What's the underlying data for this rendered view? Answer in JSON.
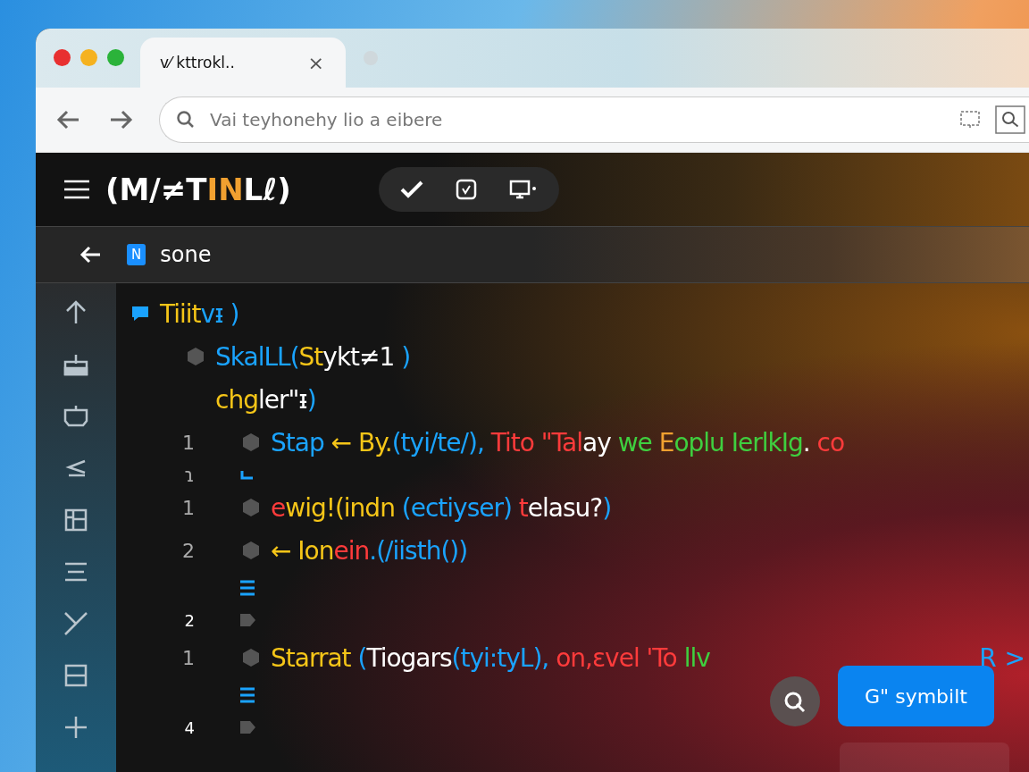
{
  "browser": {
    "tab": {
      "title": "ᴠ⁄ kttrokl..",
      "close": "×",
      "selected": true
    },
    "address": "Vai teyhonehy lio a eibere"
  },
  "app": {
    "title": [
      {
        "text": "(M/≠T",
        "color": "#ffffff"
      },
      {
        "text": "IN",
        "color": "#f0a030"
      },
      {
        "text": "Lℓ)",
        "color": "#ffffff"
      }
    ]
  },
  "breadcrumb": {
    "badge": "N",
    "label": "sone"
  },
  "code": [
    {
      "kind": "comment",
      "tokens": [
        {
          "text": "Tiiit",
          "color": "#f5c518"
        },
        {
          "text": "vᵻ )",
          "color": "#1aa3ff"
        }
      ],
      "children": [
        {
          "kind": "block",
          "tokens": [
            {
              "text": "SkalLL(",
              "color": "#1aa3ff"
            },
            {
              "text": "St",
              "color": "#f5c518"
            },
            {
              "text": "ykt≠1",
              "color": "#ffffff"
            },
            {
              "text": " )",
              "color": "#1aa3ff"
            }
          ]
        },
        {
          "kind": "plain",
          "tokens": [
            {
              "text": "chg",
              "color": "#f5c518"
            },
            {
              "text": "ler\"ᵻ",
              "color": "#ffffff"
            },
            {
              "text": ")",
              "color": "#1aa3ff"
            }
          ],
          "children": [
            {
              "kind": "block",
              "number": "1",
              "tokens": [
                {
                  "text": "Stap ",
                  "color": "#1aa3ff"
                },
                {
                  "text": "← By.",
                  "color": "#f5c518"
                },
                {
                  "text": "(tyi/te/),",
                  "color": "#1aa3ff"
                },
                {
                  "text": " Tito \"Tal",
                  "color": "#ff3b3b"
                },
                {
                  "text": "ay",
                  "color": "#ffffff"
                },
                {
                  "text": " we ",
                  "color": "#3fcf3f"
                },
                {
                  "text": "E",
                  "color": "#f0a030"
                },
                {
                  "text": "oplu IerlkIg",
                  "color": "#3fcf3f"
                },
                {
                  "text": ".",
                  "color": "#ffffff"
                },
                {
                  "text": " co",
                  "color": "#ff3b3b"
                }
              ]
            },
            {
              "kind": "mark",
              "number": "ɿ"
            },
            {
              "kind": "block",
              "number": "1",
              "tokens": [
                {
                  "text": "e",
                  "color": "#ff3b3b"
                },
                {
                  "text": "wig!(indn ",
                  "color": "#f5c518"
                },
                {
                  "text": "(ectiyser)",
                  "color": "#1aa3ff"
                },
                {
                  "text": " t",
                  "color": "#ff3b3b"
                },
                {
                  "text": "elasu?",
                  "color": "#ffffff"
                },
                {
                  "text": ")",
                  "color": "#1aa3ff"
                }
              ]
            },
            {
              "kind": "block",
              "number": "2",
              "tokens": [
                {
                  "text": "← Ion",
                  "color": "#f5c518"
                },
                {
                  "text": "ein",
                  "color": "#ff3b3b"
                },
                {
                  "text": ".(/iisth())",
                  "color": "#1aa3ff"
                }
              ]
            },
            {
              "kind": "fold"
            },
            {
              "kind": "tag",
              "number": "2"
            },
            {
              "kind": "block",
              "number": "1",
              "tokens": [
                {
                  "text": "Starrat ",
                  "color": "#f5c518"
                },
                {
                  "text": "(",
                  "color": "#1aa3ff"
                },
                {
                  "text": "Tiogars",
                  "color": "#ffffff"
                },
                {
                  "text": "(tyi:tyL),",
                  "color": "#1aa3ff"
                },
                {
                  "text": " on,ɛvel 'To",
                  "color": "#ff3b3b"
                },
                {
                  "text": " llv",
                  "color": "#3fcf3f"
                }
              ],
              "trailing": "R >"
            },
            {
              "kind": "fold"
            },
            {
              "kind": "tag",
              "number": "4"
            }
          ]
        }
      ]
    }
  ],
  "actions": {
    "primary": "G\" symbilt"
  }
}
